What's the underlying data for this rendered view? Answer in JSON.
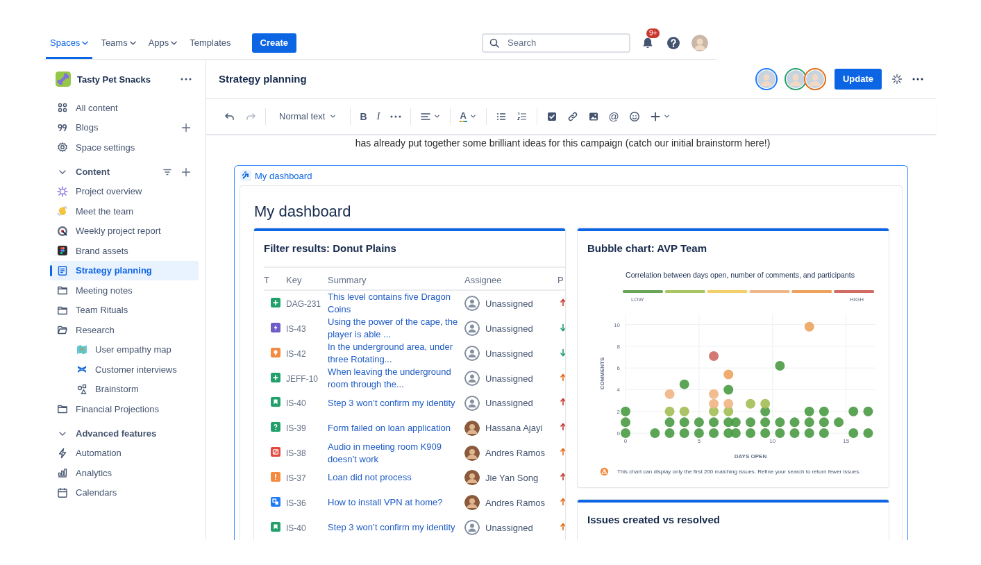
{
  "top_nav": {
    "tabs": [
      {
        "label": "Spaces",
        "selected": true,
        "dropdown": true
      },
      {
        "label": "Teams",
        "selected": false,
        "dropdown": true
      },
      {
        "label": "Apps",
        "selected": false,
        "dropdown": true
      },
      {
        "label": "Templates",
        "selected": false,
        "dropdown": false
      }
    ],
    "create_button": "Create",
    "search": {
      "placeholder": "Search"
    },
    "notifications_badge": "9+"
  },
  "sidebar": {
    "space_name": "Tasty Pet Snacks",
    "nav": [
      {
        "label": "All content",
        "kind": "grid",
        "add": false
      },
      {
        "label": "Blogs",
        "kind": "quote",
        "add": true
      },
      {
        "label": "Space settings",
        "kind": "gear",
        "add": false
      }
    ],
    "sections": [
      {
        "label": "Content",
        "expanded": true,
        "filter": true,
        "items": [
          {
            "label": "Project overview",
            "kind": "sparkle",
            "selected": false
          },
          {
            "label": "Meet the team",
            "kind": "wave",
            "selected": false
          },
          {
            "label": "Weekly project report",
            "kind": "target",
            "selected": false
          },
          {
            "label": "Brand assets",
            "kind": "figma",
            "selected": false
          },
          {
            "label": "Strategy planning",
            "kind": "page",
            "selected": true
          },
          {
            "label": "Meeting notes",
            "kind": "folder",
            "selected": false
          },
          {
            "label": "Team Rituals",
            "kind": "folder",
            "selected": false
          },
          {
            "label": "Research",
            "kind": "folder-open",
            "selected": false,
            "children": [
              {
                "label": "User empathy map",
                "kind": "map",
                "selected": false
              },
              {
                "label": "Customer interviews",
                "kind": "cross",
                "selected": false
              },
              {
                "label": "Brainstorm",
                "kind": "shapes",
                "selected": false
              }
            ]
          },
          {
            "label": "Financial Projections",
            "kind": "folder",
            "selected": false
          }
        ]
      },
      {
        "label": "Advanced features",
        "expanded": true,
        "filter": false,
        "items": [
          {
            "label": "Automation",
            "kind": "bolt",
            "selected": false
          },
          {
            "label": "Analytics",
            "kind": "bars",
            "selected": false
          },
          {
            "label": "Calendars",
            "kind": "calendar",
            "selected": false
          }
        ]
      }
    ]
  },
  "page": {
    "title": "Strategy planning",
    "collaborators": [
      {
        "color": "#1d7afc"
      },
      {
        "color": "#22a06b"
      },
      {
        "color": "#e56910"
      }
    ],
    "update_button": "Update",
    "toolbar": [
      [
        {
          "kind": "undo",
          "disabled": false
        },
        {
          "kind": "redo",
          "disabled": true
        }
      ],
      [
        {
          "kind": "style",
          "label": "Normal text",
          "disabled": false
        }
      ],
      [
        {
          "kind": "bold",
          "label": "B",
          "disabled": false
        },
        {
          "kind": "italic",
          "label": "I",
          "disabled": false
        },
        {
          "kind": "more",
          "disabled": false
        }
      ],
      [
        {
          "kind": "align",
          "disabled": false
        }
      ],
      [
        {
          "kind": "text-color",
          "label": "A",
          "disabled": false
        }
      ],
      [
        {
          "kind": "bullets",
          "disabled": false
        },
        {
          "kind": "numbers",
          "disabled": false
        }
      ],
      [
        {
          "kind": "task",
          "disabled": false
        },
        {
          "kind": "link",
          "disabled": false
        },
        {
          "kind": "image",
          "disabled": false
        },
        {
          "kind": "mention",
          "label": "@",
          "disabled": false
        },
        {
          "kind": "emoji",
          "disabled": false
        },
        {
          "kind": "insert",
          "disabled": false
        }
      ]
    ],
    "body_text": "has already put together some brilliant ideas for this campaign (catch our initial brainstorm here!)"
  },
  "dashboard": {
    "macro_label": "My dashboard",
    "title": "My dashboard",
    "filter_gadget": {
      "title": "Filter results: Donut Plains",
      "columns": [
        "T",
        "Key",
        "Summary",
        "Assignee",
        "P"
      ],
      "rows": [
        {
          "kind": "new-feature",
          "key": "DAG-231",
          "summary": "This level contains five Dragon Coins",
          "assignee": {
            "name": "Unassigned",
            "kind": "unassigned"
          },
          "priority": {
            "kind": "high"
          }
        },
        {
          "kind": "epic",
          "key": "IS-43",
          "summary": "Using the power of the cape, the player is able ...",
          "assignee": {
            "name": "Unassigned",
            "kind": "unassigned"
          },
          "priority": {
            "kind": "low"
          }
        },
        {
          "kind": "improvement",
          "key": "IS-42",
          "summary": "In the underground area, under three Rotating...",
          "assignee": {
            "name": "Unassigned",
            "kind": "unassigned"
          },
          "priority": {
            "kind": "low"
          }
        },
        {
          "kind": "new-feature",
          "key": "JEFF-10",
          "summary": "When leaving the underground room through the...",
          "assignee": {
            "name": "Unassigned",
            "kind": "unassigned"
          },
          "priority": {
            "kind": "medium"
          }
        },
        {
          "kind": "story",
          "key": "IS-40",
          "summary": "Step 3 won’t confirm my identity",
          "assignee": {
            "name": "Unassigned",
            "kind": "unassigned"
          },
          "priority": {
            "kind": "high"
          }
        },
        {
          "kind": "question",
          "key": "IS-39",
          "summary": "Form failed on loan application",
          "assignee": {
            "name": "Hassana Ajayi",
            "kind": "person"
          },
          "priority": {
            "kind": "high"
          }
        },
        {
          "kind": "bug",
          "key": "IS-38",
          "summary": "Audio in meeting room K909 doesn’t work",
          "assignee": {
            "name": "Andres Ramos",
            "kind": "person"
          },
          "priority": {
            "kind": "medium"
          }
        },
        {
          "kind": "task",
          "key": "IS-37",
          "summary": "Loan did not process",
          "assignee": {
            "name": "Jie Yan Song",
            "kind": "person"
          },
          "priority": {
            "kind": "high"
          }
        },
        {
          "kind": "subtask",
          "key": "IS-36",
          "summary": "How to install VPN at home?",
          "assignee": {
            "name": "Andres Ramos",
            "kind": "person"
          },
          "priority": {
            "kind": "medium"
          }
        },
        {
          "kind": "story",
          "key": "IS-40",
          "summary": "Step 3 won’t confirm my identity",
          "assignee": {
            "name": "Unassigned",
            "kind": "unassigned"
          },
          "priority": {
            "kind": "medium"
          }
        }
      ]
    },
    "bubble_gadget": {
      "title": "Bubble chart: AVP Team",
      "legend": {
        "items": [
          {
            "color": "#6aa55a"
          },
          {
            "color": "#a9c462"
          },
          {
            "color": "#f2cf6b"
          },
          {
            "color": "#f0b889"
          },
          {
            "color": "#eea25c"
          },
          {
            "color": "#d16b63"
          }
        ],
        "low_label": "LOW",
        "high_label": "HIGH"
      },
      "note": "This chart can display only the first 200 matching issues. Refine your search to return fewer issues.",
      "chart_data": {
        "type": "scatter",
        "title": "Correlation between days open, number of comments, and participants",
        "xlabel": "DAYS OPEN",
        "ylabel": "COMMENTS",
        "xlim": [
          0,
          17
        ],
        "ylim": [
          0,
          11
        ],
        "xticks": [
          0,
          5,
          10,
          15
        ],
        "yticks": [
          0,
          2,
          4,
          6,
          8,
          10
        ],
        "grid": true,
        "series": [
          {
            "color": "#4a9a44",
            "x": [
              0,
              0,
              0,
              2,
              3,
              3,
              4,
              4,
              5,
              5,
              6,
              6,
              7,
              7,
              7,
              4,
              7.5,
              7.5,
              8.5,
              8.5,
              9.5,
              9.5,
              9.5,
              10.5,
              10.5,
              10.5,
              11.5,
              11.5,
              12.5,
              12.5,
              12.5,
              13.5,
              13.5,
              13.5,
              14.5,
              15.5,
              15.5,
              16.5,
              16.5
            ],
            "values": [
              2,
              1,
              0,
              0,
              1,
              0,
              1,
              0,
              1,
              0,
              1,
              0,
              1,
              0,
              4,
              4.5,
              1,
              0,
              1,
              0,
              1,
              2,
              0,
              1,
              0,
              6.2,
              1,
              0,
              2,
              1,
              0,
              2,
              1,
              0,
              1,
              2,
              0,
              2,
              0
            ]
          },
          {
            "color": "#a3bd55",
            "x": [
              3,
              4,
              6,
              7,
              8.5,
              9.5
            ],
            "values": [
              2,
              2,
              2,
              2,
              2.7,
              2.7
            ]
          },
          {
            "color": "#eeb584",
            "x": [
              3,
              6,
              6,
              7
            ],
            "values": [
              3.6,
              3.6,
              2.7,
              2.7
            ]
          },
          {
            "color": "#eda35f",
            "x": [
              12.5,
              7
            ],
            "values": [
              9.8,
              5.4
            ]
          },
          {
            "color": "#cf6a62",
            "x": [
              6
            ],
            "values": [
              7.1
            ]
          }
        ]
      }
    },
    "issues_gadget": {
      "title": "Issues created vs resolved"
    }
  }
}
